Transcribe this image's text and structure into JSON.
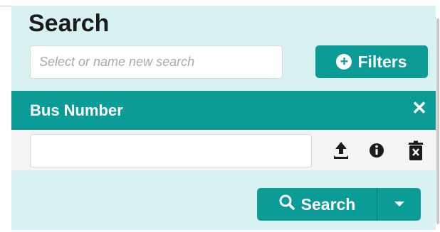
{
  "panel": {
    "title": "Search",
    "search_placeholder": "Select or name new search",
    "filters_label": "Filters"
  },
  "filter": {
    "label": "Bus Number",
    "value": ""
  },
  "actions": {
    "search_label": "Search"
  },
  "icons": {
    "filters": "plus-circle-icon",
    "close": "close-icon",
    "upload": "upload-icon",
    "info": "info-icon",
    "delete": "trash-icon",
    "search": "magnifier-icon",
    "caret": "caret-down-icon"
  },
  "colors": {
    "accent": "#0c9c98",
    "panel_bg": "#d8f1f2",
    "filter_body_bg": "#f4f4f4"
  }
}
